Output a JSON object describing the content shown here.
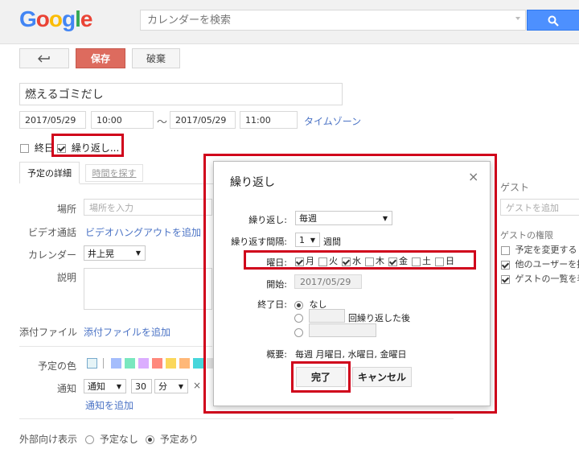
{
  "header": {
    "logo_letters": [
      {
        "ch": "G",
        "color": "#4285f4"
      },
      {
        "ch": "o",
        "color": "#ea4335"
      },
      {
        "ch": "o",
        "color": "#fbbc05"
      },
      {
        "ch": "g",
        "color": "#4285f4"
      },
      {
        "ch": "l",
        "color": "#34a853"
      },
      {
        "ch": "e",
        "color": "#ea4335"
      }
    ],
    "search_placeholder": "カレンダーを検索",
    "search_icon": "search-icon"
  },
  "toolbar": {
    "back_icon": "back-arrow-icon",
    "save_label": "保存",
    "discard_label": "破棄"
  },
  "event": {
    "title": "燃えるゴミだし",
    "start_date": "2017/05/29",
    "start_time": "10:00",
    "separator": "〜",
    "end_date": "2017/05/29",
    "end_time": "11:00",
    "timezone_link": "タイムゾーン",
    "allday_label": "終日",
    "repeat_label": "繰り返し..."
  },
  "tabs": {
    "details": "予定の詳細",
    "find_time": "時間を探す"
  },
  "details": {
    "location_label": "場所",
    "location_placeholder": "場所を入力",
    "video_label": "ビデオ通話",
    "video_link": "ビデオハングアウトを追加",
    "calendar_label": "カレンダー",
    "calendar_value": "井上晃",
    "description_label": "説明",
    "attachment_label": "添付ファイル",
    "attachment_link": "添付ファイルを追加",
    "color_label": "予定の色",
    "notify_label": "通知",
    "notify_type": "通知",
    "notify_value": "30",
    "notify_unit": "分",
    "notify_remove": "×",
    "notify_add": "通知を追加",
    "visibility_label": "外部向け表示",
    "visibility_none": "予定なし",
    "visibility_busy": "予定あり"
  },
  "guests": {
    "title": "ゲスト",
    "add_placeholder": "ゲストを追加",
    "permissions_title": "ゲストの権限",
    "perm_modify": "予定を変更する",
    "perm_invite": "他のユーザーを招",
    "perm_see_list": "ゲストの一覧を表"
  },
  "dialog": {
    "title": "繰り返し",
    "close": "×",
    "repeat_label": "繰り返し:",
    "repeat_value": "毎週",
    "interval_label": "繰り返す間隔:",
    "interval_value": "1",
    "interval_unit": "週間",
    "weekday_label": "曜日:",
    "weekdays": [
      {
        "label": "月",
        "checked": true
      },
      {
        "label": "火",
        "checked": false
      },
      {
        "label": "水",
        "checked": true
      },
      {
        "label": "木",
        "checked": false
      },
      {
        "label": "金",
        "checked": true
      },
      {
        "label": "土",
        "checked": false
      },
      {
        "label": "日",
        "checked": false
      }
    ],
    "start_label": "開始:",
    "start_value": "2017/05/29",
    "end_label": "終了日:",
    "end_never": "なし",
    "end_after_suffix": "回繰り返した後",
    "summary_label": "概要:",
    "summary_value": "毎週 月曜日, 水曜日, 金曜日",
    "done_label": "完了",
    "cancel_label": "キャンセル"
  },
  "colors": {
    "accent_red": "#d0021b",
    "link_blue": "#4b73c5",
    "save_red": "#dd6b5e",
    "search_blue": "#4d90fe",
    "swatches": [
      "#a4bdfc",
      "#7ae7bf",
      "#dbadff",
      "#ff887c",
      "#fbd75b",
      "#ffb878",
      "#46d6db",
      "#e1e1e1"
    ]
  }
}
